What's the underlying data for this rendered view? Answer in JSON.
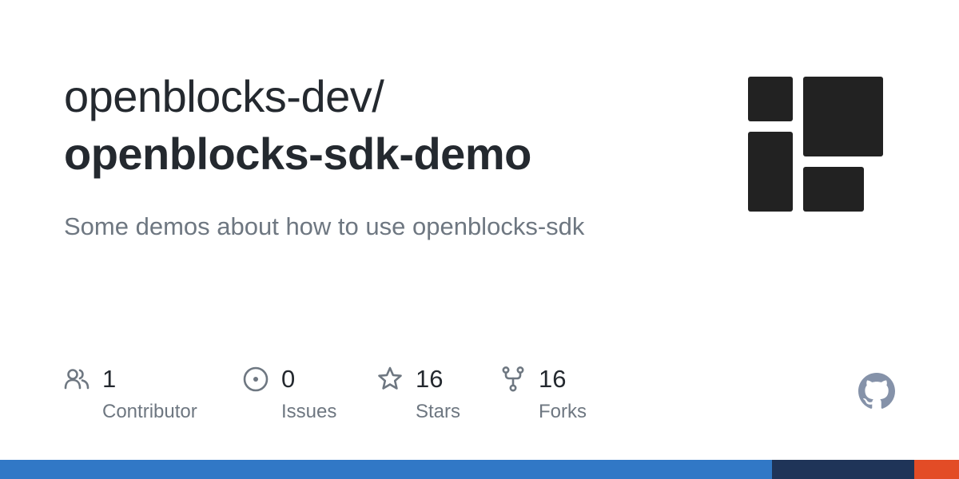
{
  "repo": {
    "owner": "openblocks-dev/",
    "name": "openblocks-sdk-demo",
    "description": "Some demos about how to use openblocks-sdk"
  },
  "logo": {
    "icon": "openblocks-logo",
    "color": "#222222"
  },
  "stats": {
    "contributors": {
      "count": "1",
      "label": "Contributor",
      "icon": "people-icon"
    },
    "issues": {
      "count": "0",
      "label": "Issues",
      "icon": "issue-opened-icon"
    },
    "stars": {
      "count": "16",
      "label": "Stars",
      "icon": "star-icon"
    },
    "forks": {
      "count": "16",
      "label": "Forks",
      "icon": "repo-forked-icon"
    }
  },
  "github_mark": {
    "icon": "github-mark-icon",
    "color": "#8592a9"
  },
  "colors": {
    "text_primary": "#24292f",
    "text_secondary": "#6e7781",
    "icon_gray": "#6e7781"
  },
  "language_bar": [
    {
      "color": "#3178c6",
      "fraction": 0.805
    },
    {
      "color": "#1f3458",
      "fraction": 0.148
    },
    {
      "color": "#e34c26",
      "fraction": 0.047
    }
  ]
}
